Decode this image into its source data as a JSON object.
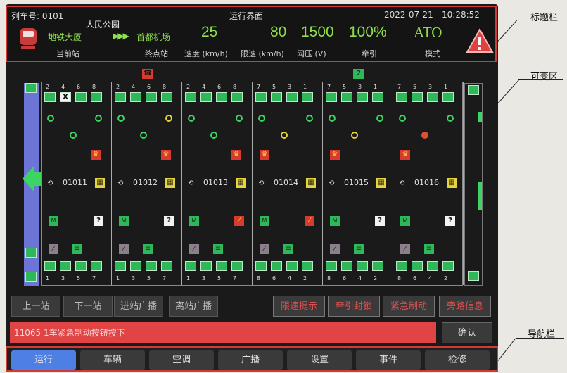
{
  "title_bar": {
    "train_no_label": "列车号: 0101",
    "screen_title": "运行界面",
    "date": "2022-07-21",
    "time": "10:28:52",
    "next_station": "人民公园",
    "current_station": "地铁大厦",
    "terminal_station": "首都机场",
    "speed": "25",
    "speed_limit": "80",
    "voltage": "1500",
    "traction": "100%",
    "mode": "ATO",
    "labels": {
      "current": "当前站",
      "terminal": "终点站",
      "speed": "速度 (km/h)",
      "limit": "限速 (km/h)",
      "voltage": "网压 (V)",
      "traction": "牵引",
      "mode": "模式"
    }
  },
  "cars": [
    {
      "id": "01011",
      "top_nums": [
        "2",
        "4",
        "6",
        "8"
      ],
      "bottom_nums": [
        "1",
        "3",
        "5",
        "7"
      ]
    },
    {
      "id": "01012",
      "top_nums": [
        "2",
        "4",
        "6",
        "8"
      ],
      "bottom_nums": [
        "1",
        "3",
        "5",
        "7"
      ]
    },
    {
      "id": "01013",
      "top_nums": [
        "2",
        "4",
        "6",
        "8"
      ],
      "bottom_nums": [
        "1",
        "3",
        "5",
        "7"
      ]
    },
    {
      "id": "01014",
      "top_nums": [
        "7",
        "5",
        "3",
        "1"
      ],
      "bottom_nums": [
        "8",
        "6",
        "4",
        "2"
      ]
    },
    {
      "id": "01015",
      "top_nums": [
        "7",
        "5",
        "3",
        "1"
      ],
      "bottom_nums": [
        "8",
        "6",
        "4",
        "2"
      ]
    },
    {
      "id": "01016",
      "top_nums": [
        "7",
        "5",
        "3",
        "1"
      ],
      "bottom_nums": [
        "8",
        "6",
        "4",
        "2"
      ]
    }
  ],
  "action_buttons_left": [
    "上一站",
    "下一站",
    "进站广播",
    "离站广播"
  ],
  "action_buttons_right": [
    "限速提示",
    "牵引封锁",
    "紧急制动",
    "旁路信息"
  ],
  "message": "11065 1车紧急制动按钮按下",
  "confirm_label": "确认",
  "nav": [
    "运行",
    "车辆",
    "空调",
    "广播",
    "设置",
    "事件",
    "检修"
  ],
  "nav_active": "运行",
  "annotations": {
    "title_bar": "标题栏",
    "variable_area": "可变区",
    "nav_bar": "导航栏"
  },
  "colors": {
    "accent_green": "#8fe04a",
    "frame_red": "#d23a3a",
    "nav_active": "#4e7fe3",
    "message_red": "#e04444"
  }
}
